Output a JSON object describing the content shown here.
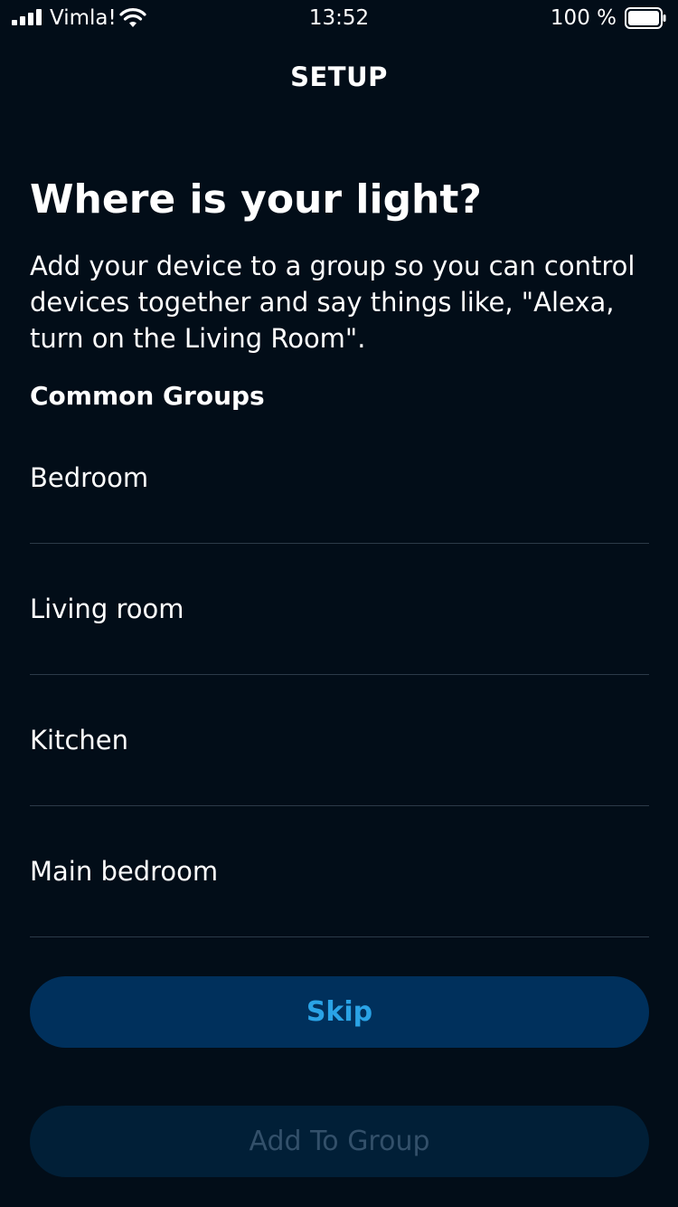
{
  "status_bar": {
    "carrier": "Vimla!",
    "time": "13:52",
    "battery_percent": "100 %",
    "icons": [
      "signal-bars-icon",
      "wifi-icon",
      "battery-icon"
    ]
  },
  "header": {
    "title": "SETUP"
  },
  "main": {
    "heading": "Where is your light?",
    "description": "Add your device to a group so you can control devices together and say things like, \"Alexa, turn on the Living Room\".",
    "section_label": "Common Groups",
    "groups": [
      {
        "label": "Bedroom"
      },
      {
        "label": "Living room"
      },
      {
        "label": "Kitchen"
      },
      {
        "label": "Main bedroom"
      }
    ]
  },
  "actions": {
    "skip_label": "Skip",
    "add_label": "Add To Group",
    "add_enabled": false
  },
  "colors": {
    "background": "#020d18",
    "divider": "#2c3a48",
    "skip_button_bg": "#00305c",
    "skip_button_text": "#2aa3e6",
    "add_button_bg": "#011f37",
    "add_button_text": "#33506a"
  }
}
